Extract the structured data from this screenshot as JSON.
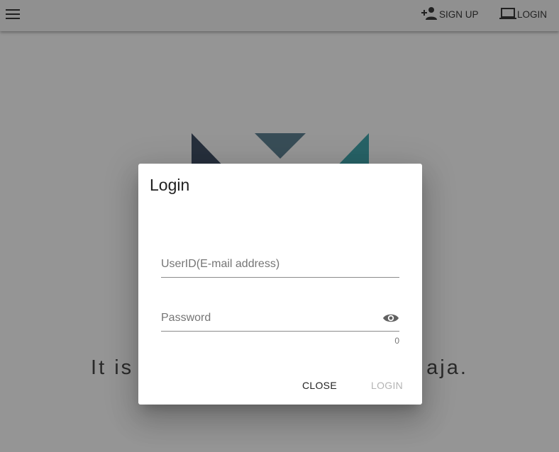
{
  "appbar": {
    "menu_icon": "hamburger-menu-icon",
    "signup": {
      "icon": "person-add-icon",
      "label": "SIGN UP"
    },
    "login": {
      "icon": "laptop-icon",
      "label": "LOGIN"
    }
  },
  "background": {
    "tagline_left": "It is",
    "tagline_right": "aja.",
    "logo_colors": [
      "#2b3c55",
      "#4e7589",
      "#2c9ea6"
    ]
  },
  "dialog": {
    "title": "Login",
    "userid": {
      "placeholder": "UserID(E-mail address)",
      "value": ""
    },
    "password": {
      "placeholder": "Password",
      "value": "",
      "counter": "0",
      "toggle_icon": "eye-icon"
    },
    "close_label": "CLOSE",
    "login_label": "LOGIN"
  },
  "colors": {
    "scrim": "#212121",
    "disabled_text": "#b4b4b4"
  }
}
